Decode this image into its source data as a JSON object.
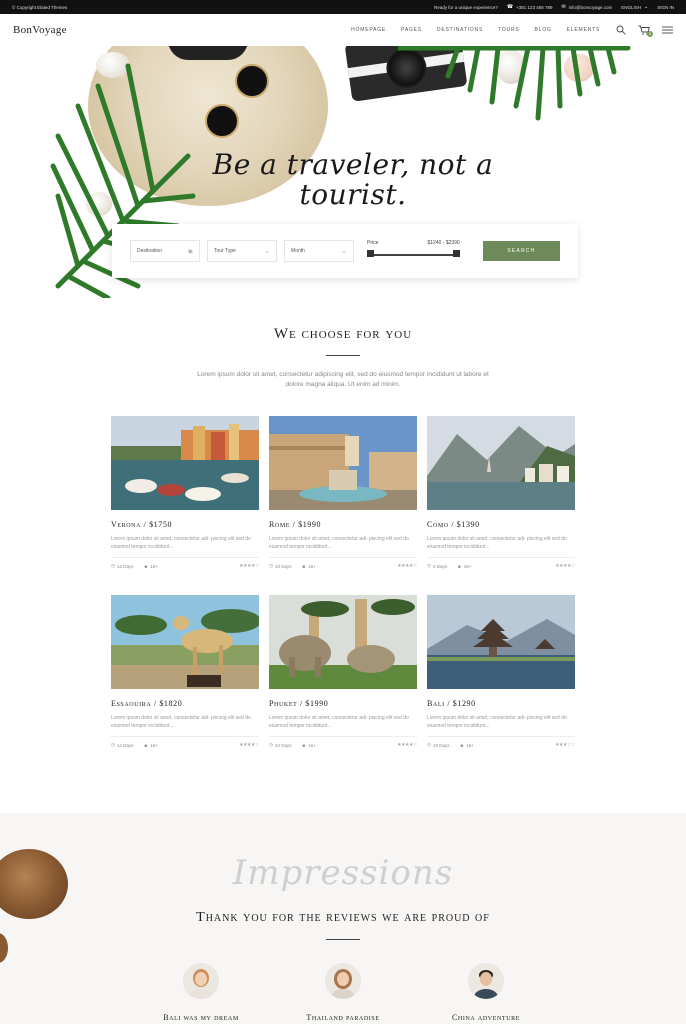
{
  "topbar": {
    "copyright": "© Copyright Elated Themes",
    "tagline": "Ready for a unique experience?",
    "phone": "+381 123 456 789",
    "email": "info@bonvoyage.com",
    "language": "ENGLISH",
    "signin": "SIGN IN"
  },
  "header": {
    "logo": "BonVoyage",
    "nav": [
      "HOMEPAGE",
      "PAGES",
      "DESTINATIONS",
      "TOURS",
      "BLOG",
      "ELEMENTS"
    ],
    "cart_count": "0"
  },
  "hero": {
    "tagline": "Be a traveler, not a tourist."
  },
  "search": {
    "destination": "Destination",
    "tour_type": "Tour Type",
    "month": "Month",
    "price_label": "Price",
    "price_range": "$1240 - $2390",
    "button": "SEARCH"
  },
  "choose": {
    "title": "We choose for you",
    "description": "Lorem ipsum dolor sit amet, consectetur adipiscing elit, sed do eiusmod tempor incididunt ut labore et dolore magna aliqua. Ut enim ad minim."
  },
  "tours": [
    {
      "title": "Verona / $1750",
      "text": "Lorem ipsum dolor sit amet, consectetur adi- piscing elit sed do eiusmod tempor incididunt...",
      "days": "13 Days",
      "age": "16+",
      "rating": 4
    },
    {
      "title": "Rome / $1990",
      "text": "Lorem ipsum dolor sit amet, consectetur adi- piscing elit sed do eiusmod tempor incididunt...",
      "days": "10 Days",
      "age": "16+",
      "rating": 4
    },
    {
      "title": "Como / $1390",
      "text": "Lorem ipsum dolor sit amet, consectetur adi- piscing elit sed do eiusmod tempor incididunt...",
      "days": "6 Days",
      "age": "16+",
      "rating": 4
    },
    {
      "title": "Essaouira / $1820",
      "text": "Lorem ipsum dolor sit amet, consectetur adi- piscing elit sed do eiusmod tempor incididunt...",
      "days": "14 Days",
      "age": "16+",
      "rating": 4
    },
    {
      "title": "Phuket / $1990",
      "text": "Lorem ipsum dolor sit amet, consectetur adi- piscing elit sed do eiusmod tempor incididunt...",
      "days": "24 Days",
      "age": "16+",
      "rating": 4
    },
    {
      "title": "Bali / $1290",
      "text": "Lorem ipsum dolor sit amet, consectetur adi- piscing elit sed do eiusmod tempor incididunt...",
      "days": "10 Days",
      "age": "16+",
      "rating": 3
    }
  ],
  "impressions": {
    "script": "Impressions",
    "title": "Thank you for the reviews we are proud of",
    "reviews": [
      {
        "title": "Bali was my dream"
      },
      {
        "title": "Thailand paradise"
      },
      {
        "title": "China adventure"
      }
    ]
  },
  "colors": {
    "accent": "#6f8a5a",
    "topbar": "#111111",
    "section_bg": "#f7f6f4"
  }
}
